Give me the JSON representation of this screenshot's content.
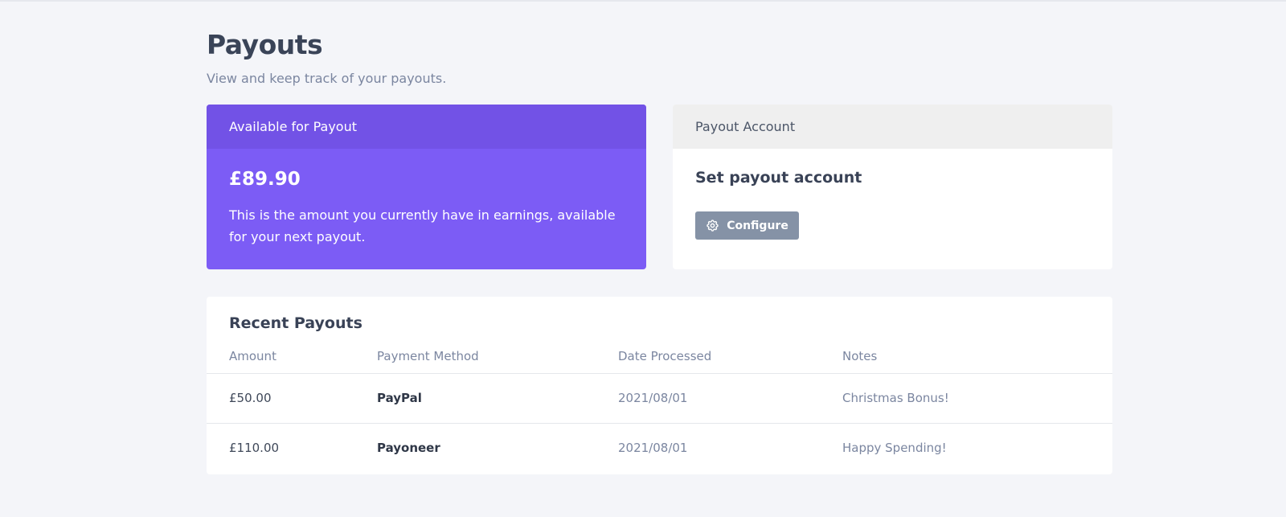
{
  "page": {
    "title": "Payouts",
    "subtitle": "View and keep track of your payouts."
  },
  "available_card": {
    "header": "Available for Payout",
    "amount": "£89.90",
    "description": "This is the amount you currently have in earnings, available for your next payout."
  },
  "account_card": {
    "header": "Payout Account",
    "title": "Set payout account",
    "configure_label": "Configure",
    "configure_icon": "gear-icon"
  },
  "recent": {
    "title": "Recent Payouts",
    "columns": [
      "Amount",
      "Payment Method",
      "Date Processed",
      "Notes"
    ],
    "rows": [
      {
        "amount": "£50.00",
        "method": "PayPal",
        "date": "2021/08/01",
        "notes": "Christmas Bonus!"
      },
      {
        "amount": "£110.00",
        "method": "Payoneer",
        "date": "2021/08/01",
        "notes": "Happy Spending!"
      }
    ]
  },
  "colors": {
    "accent": "#7c5cf5",
    "accent_dark": "#7252e6",
    "button": "#8592a6",
    "background": "#f4f5f9"
  }
}
